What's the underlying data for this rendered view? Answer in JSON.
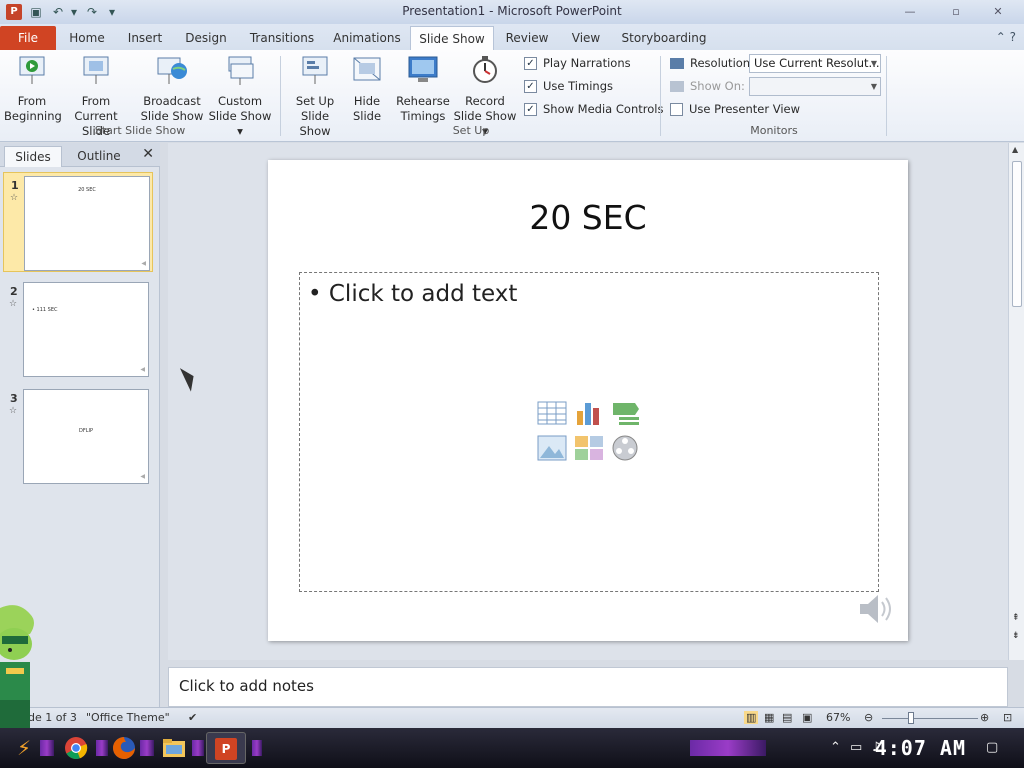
{
  "window": {
    "title": "Presentation1 - Microsoft PowerPoint",
    "minimize": "—",
    "maximize": "▫",
    "close": "✕"
  },
  "tabs": {
    "file": "File",
    "items": [
      "Home",
      "Insert",
      "Design",
      "Transitions",
      "Animations",
      "Slide Show",
      "Review",
      "View",
      "Storyboarding"
    ],
    "active": "Slide Show"
  },
  "ribbon": {
    "start_group": {
      "label": "Start Slide Show",
      "from_beginning": [
        "From",
        "Beginning"
      ],
      "from_current": [
        "From Current",
        "Slide"
      ],
      "broadcast": [
        "Broadcast",
        "Slide Show"
      ],
      "custom": [
        "Custom",
        "Slide Show ▾"
      ]
    },
    "setup_group": {
      "label": "Set Up",
      "set_up": [
        "Set Up",
        "Slide Show"
      ],
      "hide": [
        "Hide",
        "Slide"
      ],
      "rehearse": [
        "Rehearse",
        "Timings"
      ],
      "record": [
        "Record",
        "Slide Show ▾"
      ],
      "play_narrations": "Play Narrations",
      "use_timings": "Use Timings",
      "show_media": "Show Media Controls"
    },
    "monitors_group": {
      "label": "Monitors",
      "resolution_label": "Resolution:",
      "resolution_value": "Use Current Resolut...",
      "show_on_label": "Show On:",
      "presenter_view": "Use Presenter View"
    }
  },
  "pane": {
    "tab_slides": "Slides",
    "tab_outline": "Outline",
    "close": "✕",
    "slides": [
      {
        "num": "1",
        "text": "20 SEC"
      },
      {
        "num": "2",
        "text": "• 111 SEC"
      },
      {
        "num": "3",
        "text": "DFLIP"
      }
    ]
  },
  "slide": {
    "title": "20 SEC",
    "bullet": "• Click to add text"
  },
  "notes": {
    "placeholder": "Click to add notes"
  },
  "status": {
    "slide_info": "de 1 of 3",
    "theme": "\"Office Theme\"",
    "zoom": "67%"
  },
  "taskbar": {
    "time": "4:07 AM"
  },
  "colors": {
    "file_tab": "#d04423",
    "selected_thumb": "#fde9a8"
  }
}
